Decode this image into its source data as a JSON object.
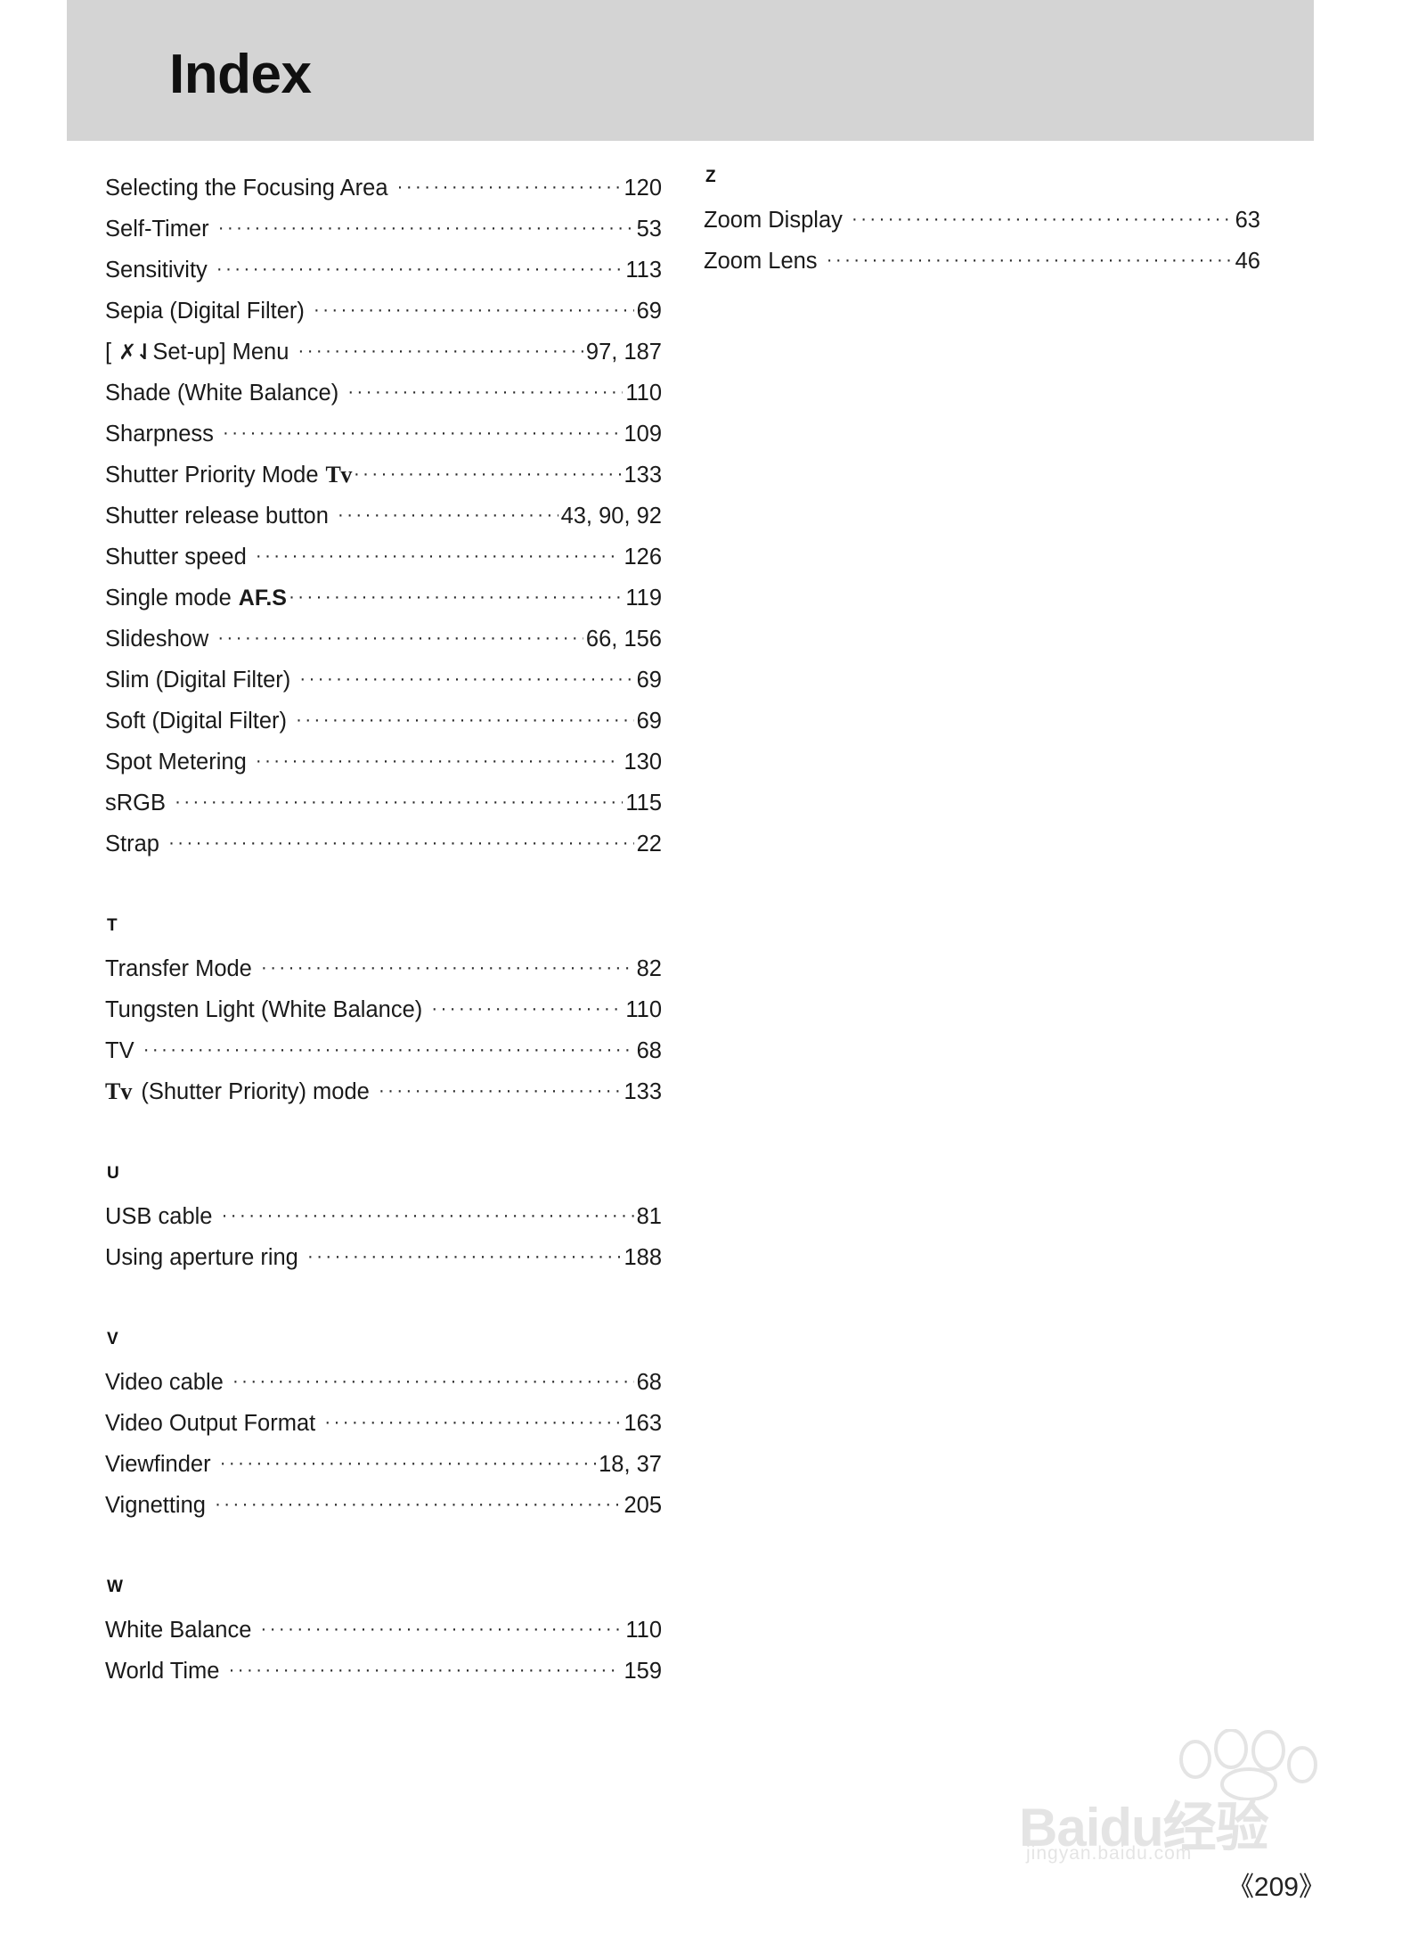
{
  "header": {
    "title": "Index"
  },
  "folio": "《209》",
  "watermark": {
    "text": "Baidu经验",
    "sub": "jingyan.baidu.com"
  },
  "columns": {
    "left": [
      {
        "type": "entries",
        "items": [
          {
            "label": "Selecting the Focusing Area",
            "page": "120"
          },
          {
            "label": "Self-Timer",
            "page": "53"
          },
          {
            "label": "Sensitivity",
            "page": "113"
          },
          {
            "label": "Sepia (Digital Filter)",
            "page": "69"
          },
          {
            "label": "[ ",
            "glyph": "setup",
            "glyph_text": "✗⇃",
            "label_after": " Set-up] Menu",
            "page": "97, 187"
          },
          {
            "label": "Shade (White Balance)",
            "page": "110"
          },
          {
            "label": "Sharpness",
            "page": "109"
          },
          {
            "label": "Shutter Priority Mode ",
            "glyph": "tv",
            "glyph_text": "Tv",
            "label_after": "",
            "page": "133"
          },
          {
            "label": "Shutter release button",
            "page": "43, 90, 92"
          },
          {
            "label": "Shutter speed",
            "page": "126"
          },
          {
            "label": "Single mode ",
            "glyph": "afs",
            "glyph_text": "AF.S",
            "label_after": "",
            "page": "119"
          },
          {
            "label": "Slideshow",
            "page": "66, 156"
          },
          {
            "label": "Slim (Digital Filter)",
            "page": "69"
          },
          {
            "label": "Soft (Digital Filter)",
            "page": "69"
          },
          {
            "label": "Spot Metering",
            "page": "130"
          },
          {
            "label": "sRGB",
            "page": "115"
          },
          {
            "label": "Strap",
            "page": "22"
          }
        ]
      },
      {
        "type": "section",
        "letter": "T",
        "items": [
          {
            "label": "Transfer Mode",
            "page": "82"
          },
          {
            "label": "Tungsten Light (White Balance)",
            "page": "110"
          },
          {
            "label": "TV",
            "page": "68"
          },
          {
            "lead_glyph": "Tv",
            "label": "(Shutter Priority) mode",
            "page": "133"
          }
        ]
      },
      {
        "type": "section",
        "letter": "U",
        "items": [
          {
            "label": "USB cable",
            "page": "81"
          },
          {
            "label": "Using aperture ring",
            "page": "188"
          }
        ]
      },
      {
        "type": "section",
        "letter": "V",
        "items": [
          {
            "label": "Video cable",
            "page": "68"
          },
          {
            "label": "Video Output Format",
            "page": "163"
          },
          {
            "label": "Viewfinder",
            "page": "18, 37"
          },
          {
            "label": "Vignetting",
            "page": "205"
          }
        ]
      },
      {
        "type": "section",
        "letter": "W",
        "items": [
          {
            "label": "White Balance",
            "page": "110"
          },
          {
            "label": "World Time",
            "page": "159"
          }
        ]
      }
    ],
    "right": [
      {
        "type": "section",
        "letter": "Z",
        "items": [
          {
            "label": "Zoom Display",
            "page": "63"
          },
          {
            "label": "Zoom Lens",
            "page": "46"
          }
        ]
      }
    ]
  }
}
